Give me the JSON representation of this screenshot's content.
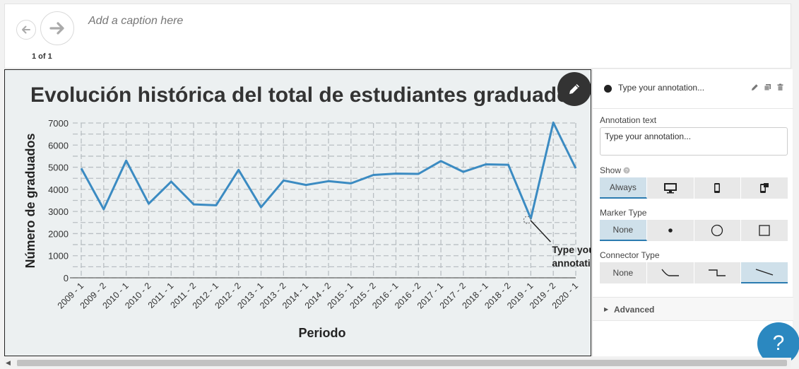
{
  "caption": {
    "placeholder": "Add a caption here",
    "page_counter": "1 of 1"
  },
  "chart_data": {
    "type": "line",
    "title": "Evolución histórica del total de estudiantes graduados",
    "xlabel": "Periodo",
    "ylabel": "Número de graduados",
    "ylim": [
      0,
      7000
    ],
    "yticks": [
      "0",
      "1000",
      "2000",
      "3000",
      "4000",
      "5000",
      "6000",
      "7000"
    ],
    "grid": true,
    "line_color": "#3b8bc2",
    "categories": [
      "2009 - 1",
      "2009 - 2",
      "2010 - 1",
      "2010 - 2",
      "2011 - 1",
      "2011 - 2",
      "2012 - 1",
      "2012 - 2",
      "2013 - 1",
      "2013 - 2",
      "2014 - 1",
      "2014 - 2",
      "2015 - 1",
      "2015 - 2",
      "2016 - 1",
      "2016 - 2",
      "2017 - 1",
      "2017 - 2",
      "2018 - 1",
      "2018 - 2",
      "2019 - 1",
      "2019 - 2",
      "2020 - 1"
    ],
    "values": [
      4950,
      3100,
      5300,
      3350,
      4350,
      3320,
      3280,
      4880,
      3190,
      4400,
      4200,
      4370,
      4270,
      4650,
      4710,
      4700,
      5280,
      4790,
      5130,
      5110,
      2680,
      7020,
      4950
    ],
    "annotation": {
      "category": "2019 - 1",
      "lines": [
        "Type your",
        "annotatio"
      ]
    }
  },
  "panel": {
    "annotation_title": "Type your annotation...",
    "annotation_text_label": "Annotation text",
    "annotation_text_value": "Type your annotation...",
    "show_label": "Show",
    "show_options": [
      "Always",
      "",
      "",
      ""
    ],
    "marker_label": "Marker Type",
    "marker_options": [
      "None",
      "",
      "",
      ""
    ],
    "connector_label": "Connector Type",
    "connector_options": [
      "None",
      "",
      "",
      ""
    ],
    "advanced_label": "Advanced"
  },
  "help": {
    "label": "?"
  },
  "colors": {
    "accent": "#2b88c0",
    "fab": "#333333",
    "active_segment": "#cfe0ea"
  }
}
